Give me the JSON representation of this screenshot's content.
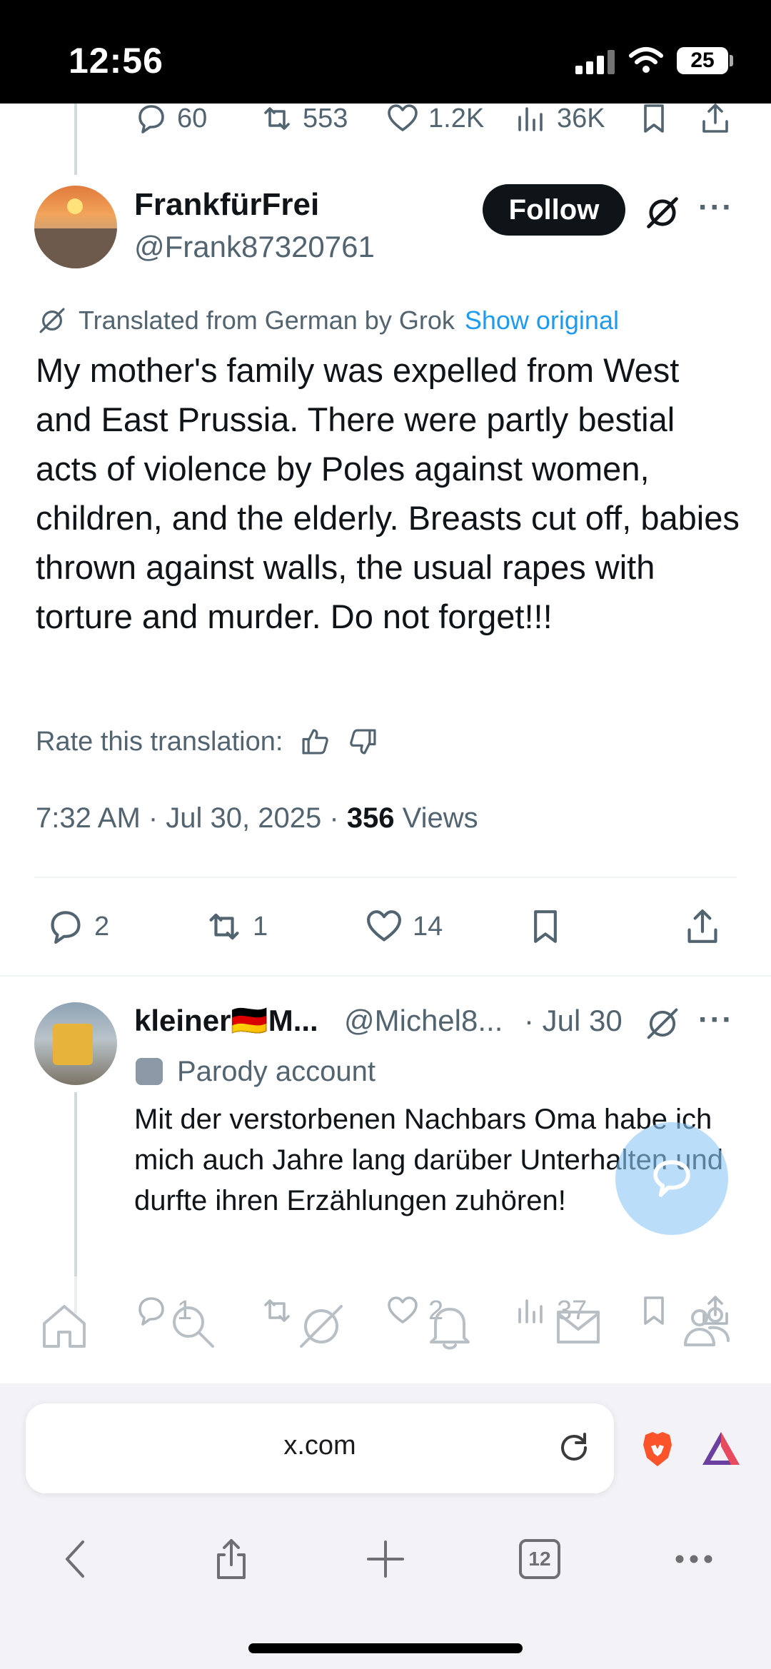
{
  "status_bar": {
    "time": "12:56",
    "battery": "25"
  },
  "prev_tweet_actions": {
    "replies": "60",
    "reposts": "553",
    "likes": "1.2K",
    "views": "36K"
  },
  "main_tweet": {
    "display_name": "FrankfürFrei",
    "handle": "@Frank87320761",
    "follow_label": "Follow",
    "translated_label": "Translated from German by Grok",
    "show_original": "Show original",
    "text": "My mother's family was expelled from West and East Prussia. There were partly bestial acts of violence by Poles against women, children, and the elderly. Breasts cut off, babies thrown against walls, the usual rapes with torture and murder. Do not forget!!!",
    "rate_label": "Rate this translation:",
    "timestamp": "7:32 AM · Jul 30, 2025 · ",
    "views_count": "356",
    "views_label": " Views",
    "actions": {
      "replies": "2",
      "reposts": "1",
      "likes": "14"
    }
  },
  "reply_tweet": {
    "display_name": "kleiner🇩🇪M...",
    "handle": "@Michel8...",
    "date": "· Jul 30",
    "badge": "Parody account",
    "text": "Mit der verstorbenen Nachbars Oma habe ich mich auch Jahre lang darüber Unterhalten und durfte ihren Erzählungen zuhören!",
    "actions": {
      "replies": "1",
      "reposts": "",
      "likes": "2",
      "views": "37"
    }
  },
  "browser": {
    "url": "x.com",
    "tab_count": "12"
  },
  "colors": {
    "accent": "#1d9bf0",
    "text": "#0f1419",
    "muted": "#536471"
  }
}
